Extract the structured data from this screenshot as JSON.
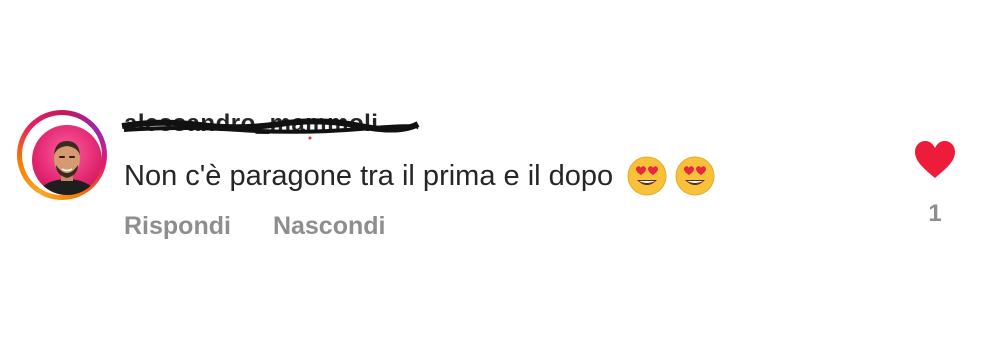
{
  "comment": {
    "username": "alessandro_mammoli",
    "text": "Non c'è paragone tra il prima e il dopo",
    "emojis": [
      "heart-eyes-emoji",
      "heart-eyes-emoji"
    ],
    "actions": {
      "reply_label": "Rispondi",
      "hide_label": "Nascondi"
    },
    "like_count": "1",
    "like_color": "#ed4956",
    "text_color": "#262626",
    "secondary_color": "#8e8e8e"
  }
}
